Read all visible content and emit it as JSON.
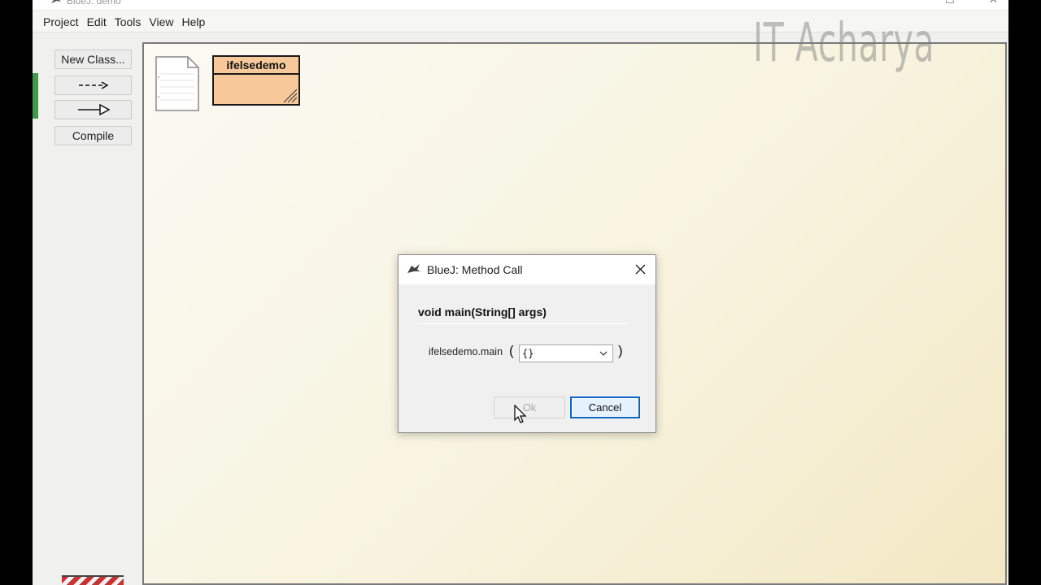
{
  "window": {
    "title": "BlueJ: demo",
    "controls": {
      "maximize": "☐",
      "close": "✕"
    }
  },
  "menu": [
    "Project",
    "Edit",
    "Tools",
    "View",
    "Help"
  ],
  "toolbar": {
    "new_class": "New Class...",
    "uses_arrow": "uses-arrow-icon",
    "inherit_arrow": "inherits-arrow-icon",
    "compile": "Compile"
  },
  "diagram": {
    "class_name": "ifelsedemo",
    "class_color": "#f7c99a",
    "readme_icon": "readme-document-icon"
  },
  "watermark": "IT Acharya",
  "dialog": {
    "title": "BlueJ:  Method Call",
    "signature": "void main(String[] args)",
    "call_label": "ifelsedemo.main",
    "open_paren": "(",
    "close_paren": ")",
    "argument_value": "{}",
    "ok_label": "Ok",
    "cancel_label": "Cancel",
    "ok_enabled": false
  },
  "colors": {
    "accent_green": "#3d9b4a",
    "focus_blue": "#0a64c8"
  }
}
